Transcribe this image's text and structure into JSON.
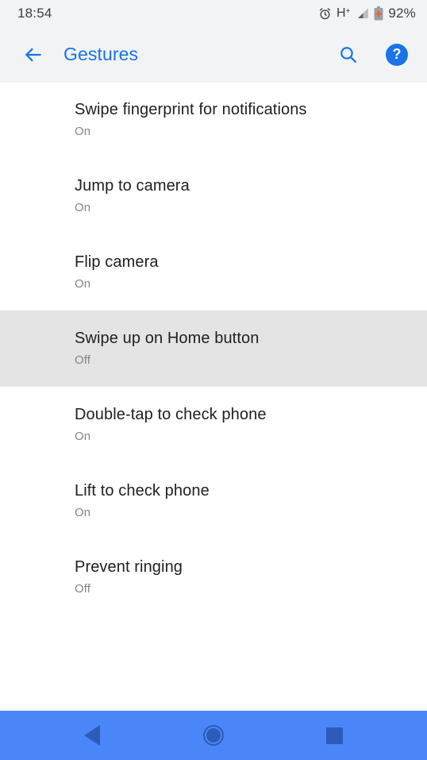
{
  "status_bar": {
    "time": "18:54",
    "alarm_icon": "alarm-clock-icon",
    "network_type": "H",
    "network_sup": "+",
    "signal_icon": "signal-bars-icon",
    "battery_icon": "battery-saver-icon",
    "battery_percent": "92%"
  },
  "app_bar": {
    "back_icon": "arrow-back-icon",
    "title": "Gestures",
    "search_icon": "search-icon",
    "help_icon": "help-icon",
    "help_glyph": "?",
    "accent_color": "#1a73e8",
    "background_color": "#f1f3f4"
  },
  "list": {
    "items": [
      {
        "title": "Swipe fingerprint for notifications",
        "state": "On",
        "selected": false
      },
      {
        "title": "Jump to camera",
        "state": "On",
        "selected": false
      },
      {
        "title": "Flip camera",
        "state": "On",
        "selected": false
      },
      {
        "title": "Swipe up on Home button",
        "state": "Off",
        "selected": true
      },
      {
        "title": "Double-tap to check phone",
        "state": "On",
        "selected": false
      },
      {
        "title": "Lift to check phone",
        "state": "On",
        "selected": false
      },
      {
        "title": "Prevent ringing",
        "state": "Off",
        "selected": false
      }
    ],
    "selected_background": "#e4e4e4"
  },
  "nav_bar": {
    "background_color": "#4a86f7",
    "icon_color": "#2d5bba",
    "back_icon": "nav-back-triangle-icon",
    "home_icon": "nav-home-circle-icon",
    "recents_icon": "nav-recents-square-icon"
  }
}
